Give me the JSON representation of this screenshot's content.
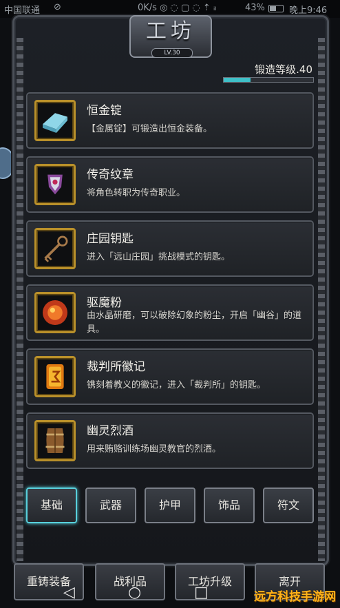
{
  "status_bar": {
    "carrier": "中国联通",
    "carrier_symbol": "⊘",
    "network": "0K/s ◎ ◌ ▢ ◌ ⇡ ᵢₗ",
    "battery_text": "43%",
    "time": "晚上9:46"
  },
  "header": {
    "title": "工坊",
    "level_badge": "LV.30",
    "forge_level_label": "锻造等级.40",
    "forge_progress_pct": 30
  },
  "items": [
    {
      "name": "恒金锭",
      "description": "【金属锭】可锻造出恒金装备。",
      "icon": "metal-ingot-icon"
    },
    {
      "name": "传奇纹章",
      "description": "将角色转职为传奇职业。",
      "icon": "emblem-icon"
    },
    {
      "name": "庄园钥匙",
      "description": "进入「远山庄园」挑战模式的钥匙。",
      "icon": "key-icon"
    },
    {
      "name": "驱魔粉",
      "description": "由水晶研磨，可以破除幻象的粉尘，开启「幽谷」的道具。",
      "icon": "powder-icon"
    },
    {
      "name": "裁判所徽记",
      "description": "镌刻着教义的徽记，进入「裁判所」的钥匙。",
      "icon": "insignia-icon"
    },
    {
      "name": "幽灵烈酒",
      "description": "用来贿赂训练场幽灵教官的烈酒。",
      "icon": "barrel-icon"
    }
  ],
  "tabs": [
    {
      "label": "基础",
      "active": true
    },
    {
      "label": "武器",
      "active": false
    },
    {
      "label": "护甲",
      "active": false
    },
    {
      "label": "饰品",
      "active": false
    },
    {
      "label": "符文",
      "active": false
    }
  ],
  "bottom_buttons": [
    "重铸装备",
    "战利品",
    "工坊升级",
    "离开"
  ],
  "nav_icons": [
    "back-icon",
    "home-icon",
    "recents-icon"
  ],
  "watermark": "远方科技手游网",
  "colors": {
    "accent": "#58d0dc",
    "icon_frame": "#b9902a",
    "progress": "#3fc0c8"
  }
}
